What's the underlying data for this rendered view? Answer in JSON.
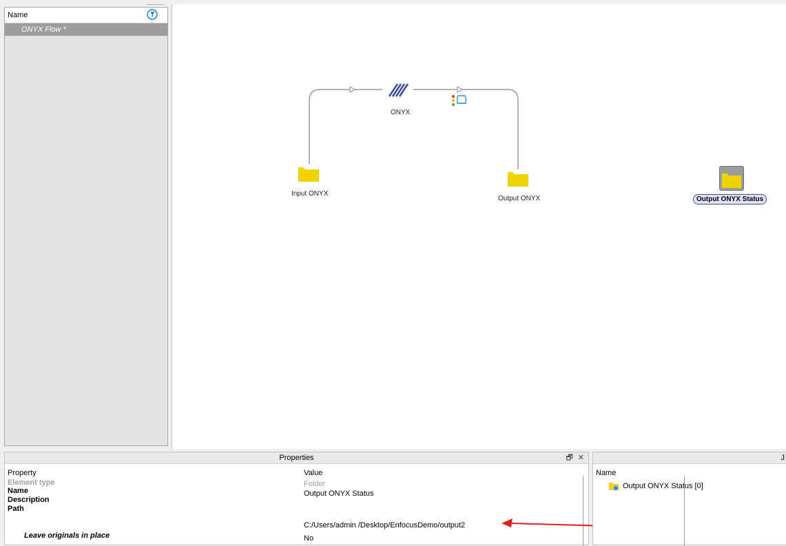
{
  "flows_panel": {
    "header_label": "Name",
    "filter_icon": "filter-icon",
    "items": [
      {
        "label": "ONYX Flow *",
        "selected": true
      }
    ]
  },
  "canvas": {
    "nodes": {
      "input_folder": {
        "label": "Input ONYX",
        "icon": "folder-icon"
      },
      "onyx_app": {
        "label": "ONYX",
        "icon": "onyx-logo-icon"
      },
      "output_folder": {
        "label": "Output ONYX",
        "icon": "folder-icon"
      },
      "status_folder": {
        "label": "Output ONYX Status",
        "icon": "folder-icon",
        "selected": true
      }
    },
    "connection_icon": "traffic-light-printer-icon",
    "colors": {
      "folder": "#f0d800",
      "connector": "#999999",
      "selection_border": "#3c4f9a"
    }
  },
  "properties": {
    "title": "Properties",
    "float_control": "🗗",
    "close_control": "✕",
    "columns": {
      "property": "Property",
      "value": "Value"
    },
    "rows": [
      {
        "name": "Element type",
        "value": "Folder"
      },
      {
        "name": "Name",
        "value": "Output ONYX Status"
      },
      {
        "name": "Description",
        "value": ""
      },
      {
        "name": "Path",
        "value": "C:/Users/admin /Desktop/EnfocusDemo/output2"
      },
      {
        "name": "Leave originals in place",
        "value": "No"
      }
    ]
  },
  "jobs": {
    "title_partial": "J",
    "header_label": "Name",
    "items": [
      {
        "label": "Output ONYX Status [0]",
        "icon": "folder-job-icon"
      }
    ]
  },
  "annotation": {
    "arrow_color": "#e02020"
  }
}
